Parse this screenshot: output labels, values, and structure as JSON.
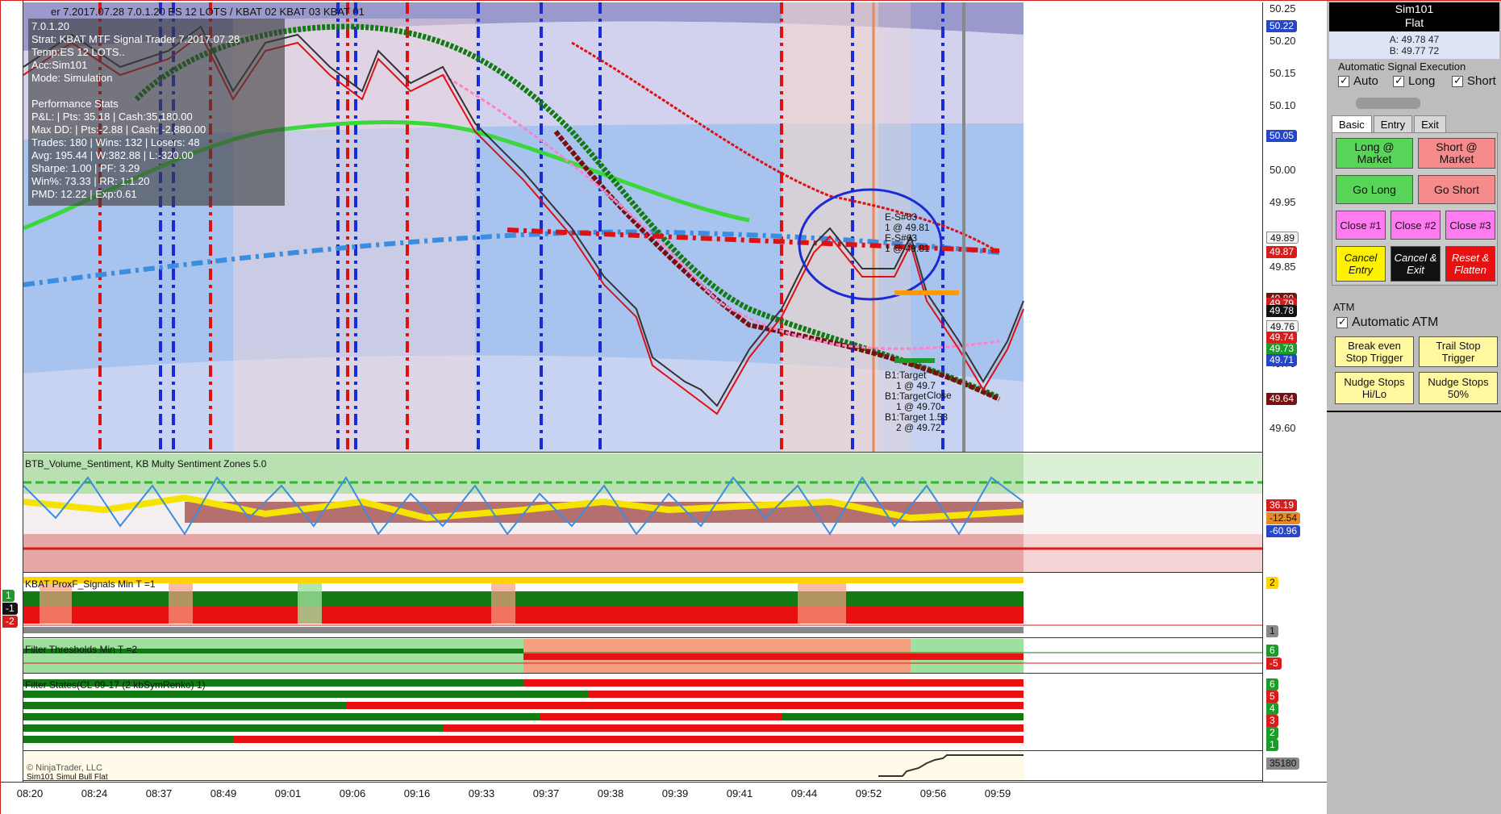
{
  "title_strip": "er 7.2017.07.28 7.0.1.20 ES 12 LOTS /   KBAT 02   KBAT 03   KBAT 01",
  "info_box": {
    "lines": [
      "7.0.1.20",
      "Strat:  KBAT MTF Signal Trader 7.2017.07.28",
      "Temp:ES 12 LOTS..",
      "Acc:Sim101",
      "Mode: Simulation",
      "",
      "Performance Stats",
      "P&L: | Pts: 35.18 | Cash:35,180.00",
      "Max DD: | Pts:-2.88 | Cash: -2,880.00",
      "Trades: 180 | Wins: 132 | Losers: 48",
      "Avg: 195.44 | W:382.88 | L:-320.00",
      "Sharpe: 1.00 | PF: 3.29",
      "Win%: 73.33 | RR: 1:1.20",
      "PMD: 12.22 | Exp:0.61"
    ]
  },
  "chart_annotations": {
    "es1": "E-S#63",
    "es1b": "1 @ 49.81",
    "es2": "E-S#63",
    "es2b": "1 @ 49.81",
    "t1": "B1:Target",
    "t1b": "1 @ 49.7",
    "t2": "B1:Target",
    "t2b": "1 @ 49.70",
    "t3": "B1:Target 1.53",
    "t3b": "2 @ 49.72",
    "close": "Close"
  },
  "price_axis": {
    "ticks": [
      "50.25",
      "50.20",
      "50.15",
      "50.10",
      "50.00",
      "49.95",
      "49.85",
      "49.70",
      "49.60"
    ],
    "tags": [
      {
        "text": "50.22",
        "style": "blue"
      },
      {
        "text": "50.05",
        "style": "blue"
      },
      {
        "text": "49.89",
        "style": "white"
      },
      {
        "text": "49.87",
        "style": "red"
      },
      {
        "text": "49.80",
        "style": "maroon"
      },
      {
        "text": "49.79",
        "style": "red"
      },
      {
        "text": "49.78",
        "style": "dark"
      },
      {
        "text": "49.76",
        "style": "white"
      },
      {
        "text": "49.74",
        "style": "red"
      },
      {
        "text": "49.73",
        "style": "green"
      },
      {
        "text": "49.71",
        "style": "blue"
      },
      {
        "text": "49.64",
        "style": "maroon"
      }
    ]
  },
  "vol_pane": {
    "title": "BTB_Volume_Sentiment,            KB Multy Sentiment Zones 5.0",
    "tags": [
      {
        "text": "36.19",
        "style": "red"
      },
      {
        "text": "-12.54",
        "style": "orange"
      },
      {
        "text": "-60.96",
        "style": "blue"
      }
    ]
  },
  "prox_pane": {
    "title": "KBAT ProxF_Signals   Min T =1",
    "left_tags": [
      {
        "text": "1",
        "style": "green"
      },
      {
        "text": "-1",
        "style": "dark"
      },
      {
        "text": "-2",
        "style": "red"
      }
    ],
    "right_tags": [
      {
        "text": "2",
        "style": "yellow"
      },
      {
        "text": "1",
        "style": "gray"
      }
    ]
  },
  "threshold_pane": {
    "title": "Filter Thresholds   Min T =2",
    "tags": [
      {
        "text": "6",
        "style": "green"
      },
      {
        "text": "-5",
        "style": "red"
      }
    ]
  },
  "states_pane": {
    "title": "Filter States(CL 09-17 (2 kbSymRenko) 1)",
    "tags": [
      {
        "text": "6",
        "style": "green"
      },
      {
        "text": "5",
        "style": "red"
      },
      {
        "text": "4",
        "style": "green"
      },
      {
        "text": "3",
        "style": "red"
      },
      {
        "text": "2",
        "style": "green"
      },
      {
        "text": "1",
        "style": "green"
      }
    ]
  },
  "pnl_pane": {
    "title": "© NinjaTrader, LLC",
    "footer": "Sim101 Simul  Bull Flat",
    "tag": "35180"
  },
  "time_axis": [
    "08:20",
    "08:24",
    "08:37",
    "08:49",
    "09:01",
    "09:06",
    "09:16",
    "09:33",
    "09:37",
    "09:38",
    "09:39",
    "09:41",
    "09:44",
    "09:52",
    "09:56",
    "09:59"
  ],
  "panel": {
    "account": "Sim101",
    "position": "Flat",
    "ask": "A: 49.78 47",
    "bid": "B: 49.77 72",
    "ase_label": "Automatic Signal Execution",
    "auto_label": "Auto",
    "long_label": "Long",
    "short_label": "Short",
    "tabs": [
      "Basic",
      "Entry",
      "Exit"
    ],
    "buttons": {
      "long_market": "Long @ Market",
      "short_market": "Short @ Market",
      "go_long": "Go Long",
      "go_short": "Go Short",
      "close1": "Close #1",
      "close2": "Close #2",
      "close3": "Close #3",
      "cancel_entry": "Cancel Entry",
      "cancel_exit": "Cancel & Exit",
      "reset_flatten": "Reset & Flatten"
    },
    "atm_label": "ATM",
    "auto_atm_label": "Automatic ATM",
    "atm_buttons": {
      "break_even": "Break even Stop Trigger",
      "trail_stop": "Trail Stop Trigger",
      "nudge_hilo": "Nudge Stops Hi/Lo",
      "nudge_50": "Nudge Stops 50%"
    }
  },
  "colors": {
    "bull": "#1d9b2a",
    "bear": "#d81b1b",
    "accent_blue": "#2646c8"
  }
}
